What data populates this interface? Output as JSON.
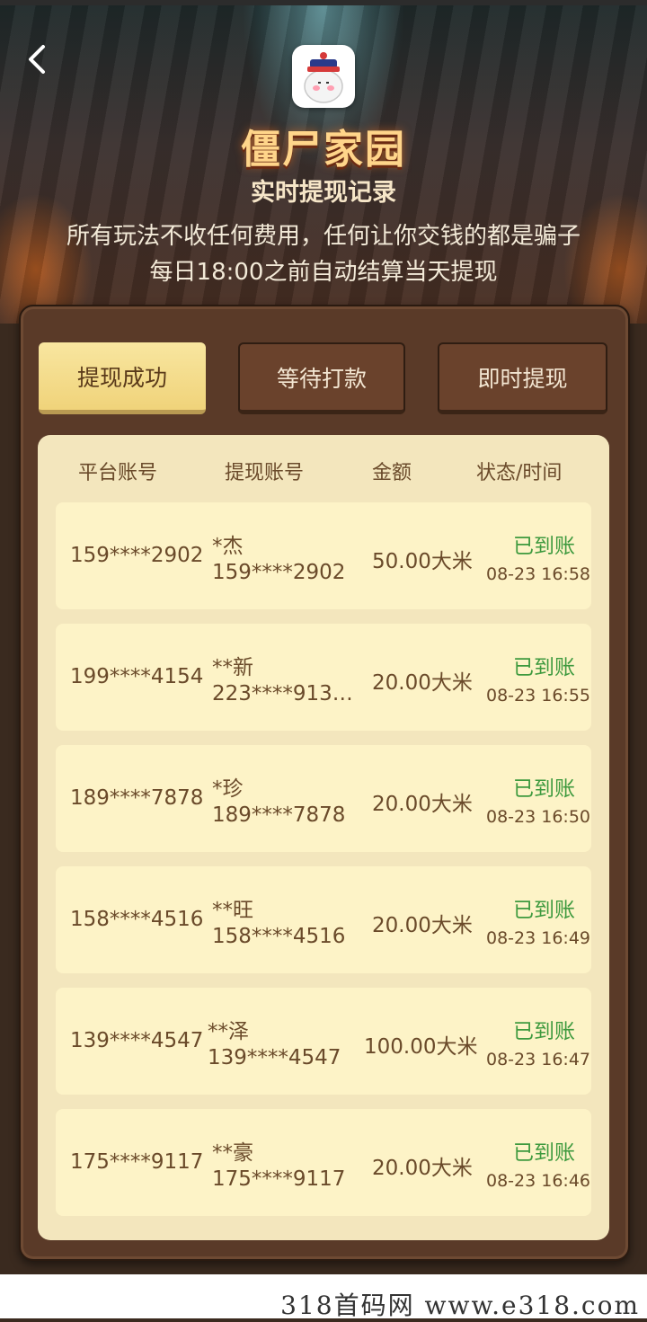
{
  "header": {
    "app_title": "僵尸家园",
    "subtitle": "实时提现记录",
    "notice_1": "所有玩法不收任何费用，任何让你交钱的都是骗子",
    "notice_2": "每日18:00之前自动结算当天提现"
  },
  "tabs": [
    {
      "label": "提现成功",
      "active": true
    },
    {
      "label": "等待打款",
      "active": false
    },
    {
      "label": "即时提现",
      "active": false
    }
  ],
  "table": {
    "headers": [
      "平台账号",
      "提现账号",
      "金额",
      "状态/时间"
    ],
    "rows": [
      {
        "platform": "159****2902",
        "name": "*杰",
        "account": "159****2902",
        "amount": "50.00大米",
        "status": "已到账",
        "time": "08-23 16:58"
      },
      {
        "platform": "199****4154",
        "name": "**新",
        "account": "223****913…",
        "amount": "20.00大米",
        "status": "已到账",
        "time": "08-23 16:55"
      },
      {
        "platform": "189****7878",
        "name": "*珍",
        "account": "189****7878",
        "amount": "20.00大米",
        "status": "已到账",
        "time": "08-23 16:50"
      },
      {
        "platform": "158****4516",
        "name": "**旺",
        "account": "158****4516",
        "amount": "20.00大米",
        "status": "已到账",
        "time": "08-23 16:49"
      },
      {
        "platform": "139****4547",
        "name": "**泽",
        "account": "139****4547",
        "amount": "100.00大米",
        "status": "已到账",
        "time": "08-23 16:47"
      },
      {
        "platform": "175****9117",
        "name": "**豪",
        "account": "175****9117",
        "amount": "20.00大米",
        "status": "已到账",
        "time": "08-23 16:46"
      }
    ]
  },
  "watermark": "318首码网  www.e318.com",
  "colors": {
    "status_green": "#3f9a3f",
    "title_gold": "#ffd58a",
    "panel_brown": "#5a3a28",
    "table_bg": "#f3e6bd",
    "row_bg": "#fdf3c7"
  },
  "icons": [
    "back-chevron-icon",
    "app-logo-icon"
  ]
}
